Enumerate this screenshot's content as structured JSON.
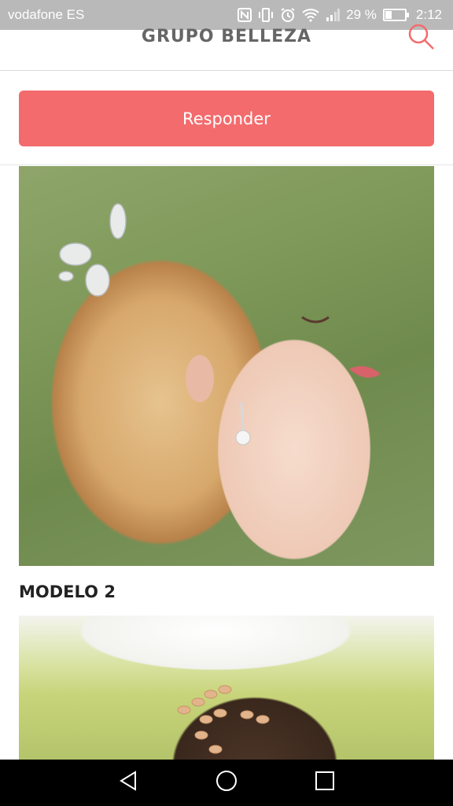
{
  "status_bar": {
    "carrier": "vodafone ES",
    "battery_percent": "29 %",
    "time": "2:12",
    "icons": [
      "nfc-icon",
      "vibrate-icon",
      "alarm-icon",
      "wifi-icon",
      "signal-icon",
      "battery-icon"
    ]
  },
  "header": {
    "title": "GRUPO BELLEZA",
    "search_icon": "search-icon"
  },
  "reply": {
    "label": "Responder"
  },
  "content": {
    "images": [
      {
        "alt": "bridal-ponytail-hairstyle-photo"
      },
      {
        "alt": "bridal-updo-hairstyle-photo"
      }
    ],
    "section_heading": "MODELO 2"
  },
  "nav_bar": {
    "buttons": [
      "back-icon",
      "home-icon",
      "recents-icon"
    ]
  },
  "colors": {
    "accent": "#f36b6d",
    "status_bar": "#b9b9b9",
    "title_gray": "#666666"
  }
}
